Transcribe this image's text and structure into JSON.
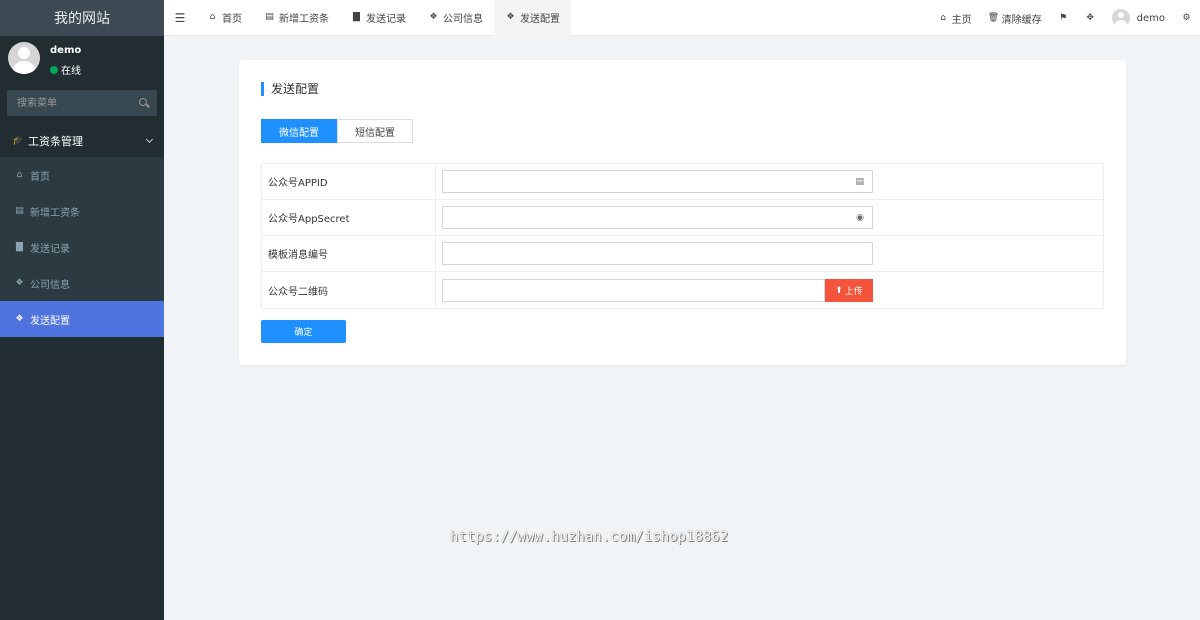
{
  "sidebar": {
    "brand": "我的网站",
    "user": {
      "name": "demo",
      "status": "在线"
    },
    "search_placeholder": "搜索菜单",
    "group_label": "工资条管理",
    "items": [
      {
        "label": "首页",
        "icon": "home-icon"
      },
      {
        "label": "新增工资条",
        "icon": "list-icon"
      },
      {
        "label": "发送记录",
        "icon": "file-icon"
      },
      {
        "label": "公司信息",
        "icon": "cubes-icon"
      },
      {
        "label": "发送配置",
        "icon": "cubes-icon",
        "active": true
      }
    ]
  },
  "topbar": {
    "tabs": [
      {
        "label": "首页",
        "icon": "home-icon"
      },
      {
        "label": "新增工资条",
        "icon": "list-icon"
      },
      {
        "label": "发送记录",
        "icon": "file-icon"
      },
      {
        "label": "公司信息",
        "icon": "cubes-icon"
      },
      {
        "label": "发送配置",
        "icon": "cubes-icon",
        "active": true
      }
    ],
    "right": {
      "home_label": "主页",
      "clear_cache_label": "清除缓存",
      "username": "demo"
    }
  },
  "main": {
    "title": "发送配置",
    "config_tabs": [
      {
        "label": "微信配置",
        "active": true
      },
      {
        "label": "短信配置",
        "active": false
      }
    ],
    "fields": [
      {
        "label": "公众号APPID",
        "value": ""
      },
      {
        "label": "公众号AppSecret",
        "value": ""
      },
      {
        "label": "模板消息编号",
        "value": ""
      },
      {
        "label": "公众号二维码",
        "value": ""
      }
    ],
    "upload_label": "上传",
    "submit_label": "确定"
  },
  "watermark": "https://www.huzhan.com/ishop18862",
  "colors": {
    "sidebar_bg": "#222d32",
    "active_menu": "#4e73df",
    "primary": "#1e90ff",
    "danger": "#f4543c"
  }
}
